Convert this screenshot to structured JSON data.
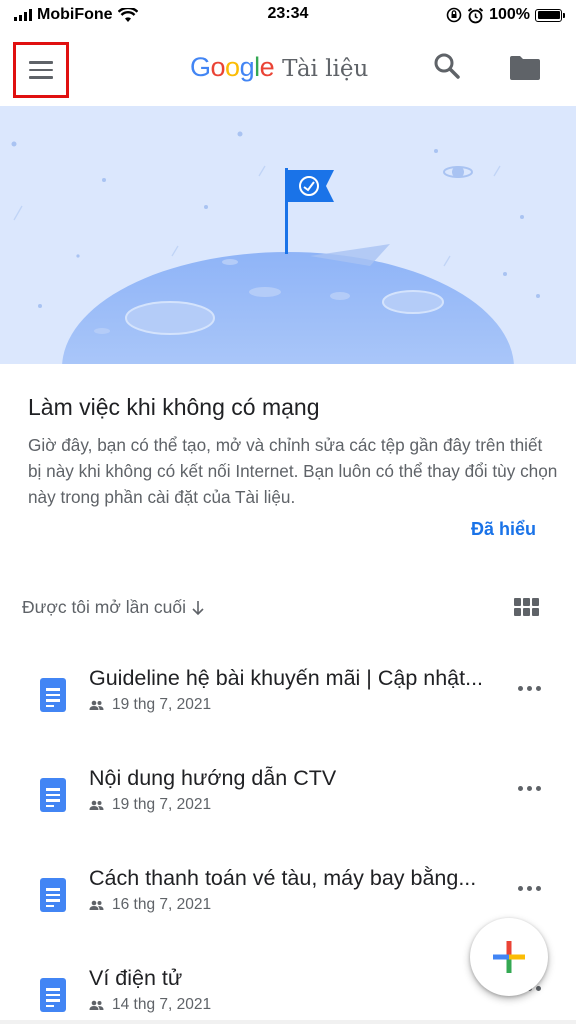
{
  "status_bar": {
    "carrier": "MobiFone",
    "time": "23:34",
    "battery": "100%",
    "icons": [
      "signal-icon",
      "wifi-icon",
      "rotation-lock-icon",
      "alarm-icon",
      "battery-icon"
    ]
  },
  "app_bar": {
    "logo_google": "Google",
    "logo_product": "Tài liệu",
    "icons": [
      "menu-icon",
      "search-icon",
      "folder-icon"
    ]
  },
  "offline_card": {
    "title": "Làm việc khi không có mạng",
    "description": "Giờ đây, bạn có thể tạo, mở và chỉnh sửa các tệp gần đây trên thiết bị này khi không có kết nối Internet. Bạn luôn có thể thay đổi tùy chọn này trong phần cài đặt của Tài liệu.",
    "action": "Đã hiểu"
  },
  "section": {
    "sort_label": "Được tôi mở lần cuối",
    "icons": [
      "arrow-down-icon",
      "grid-view-icon"
    ]
  },
  "files": [
    {
      "title": "Guideline hệ bài khuyến mãi | Cập nhật...",
      "date": "19 thg 7, 2021"
    },
    {
      "title": "Nội dung hướng dẫn CTV",
      "date": "19 thg 7, 2021"
    },
    {
      "title": "Cách thanh toán vé tàu, máy bay bằng...",
      "date": "16 thg 7, 2021"
    },
    {
      "title": "Ví điện tử",
      "date": "14 thg 7, 2021"
    }
  ],
  "colors": {
    "accent": "#1a73e8",
    "doc_icon": "#4285f4",
    "banner_bg": "#dbe7fd",
    "highlight_border": "#e01010"
  }
}
